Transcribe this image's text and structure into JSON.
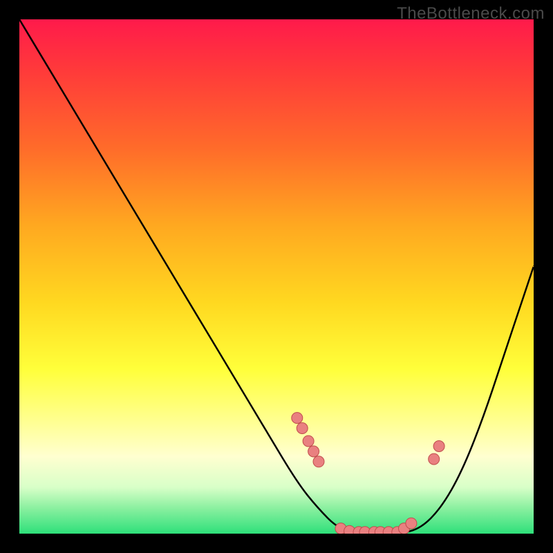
{
  "watermark": "TheBottleneck.com",
  "colors": {
    "background": "#000000",
    "curve_stroke": "#000000",
    "dot_fill": "#e98080",
    "dot_stroke": "#c04c4c"
  },
  "chart_data": {
    "type": "line",
    "title": "",
    "xlabel": "",
    "ylabel": "",
    "xlim": [
      0,
      1
    ],
    "ylim": [
      0,
      1
    ],
    "series": [
      {
        "name": "bottleneck-curve",
        "x": [
          0.0,
          0.06,
          0.12,
          0.18,
          0.24,
          0.3,
          0.36,
          0.42,
          0.48,
          0.54,
          0.58,
          0.62,
          0.66,
          0.7,
          0.74,
          0.78,
          0.82,
          0.86,
          0.9,
          0.94,
          0.98,
          1.0
        ],
        "y": [
          1.0,
          0.9,
          0.8,
          0.7,
          0.6,
          0.5,
          0.4,
          0.3,
          0.2,
          0.1,
          0.05,
          0.01,
          0.0,
          0.0,
          0.0,
          0.01,
          0.05,
          0.12,
          0.22,
          0.34,
          0.46,
          0.52
        ]
      }
    ],
    "highlight_points": {
      "name": "dots",
      "x": [
        0.54,
        0.55,
        0.562,
        0.572,
        0.582,
        0.625,
        0.642,
        0.66,
        0.672,
        0.69,
        0.702,
        0.718,
        0.735,
        0.748,
        0.762,
        0.806,
        0.816
      ],
      "y": [
        0.225,
        0.205,
        0.18,
        0.16,
        0.14,
        0.01,
        0.005,
        0.003,
        0.003,
        0.003,
        0.003,
        0.003,
        0.003,
        0.01,
        0.02,
        0.145,
        0.17
      ]
    }
  }
}
